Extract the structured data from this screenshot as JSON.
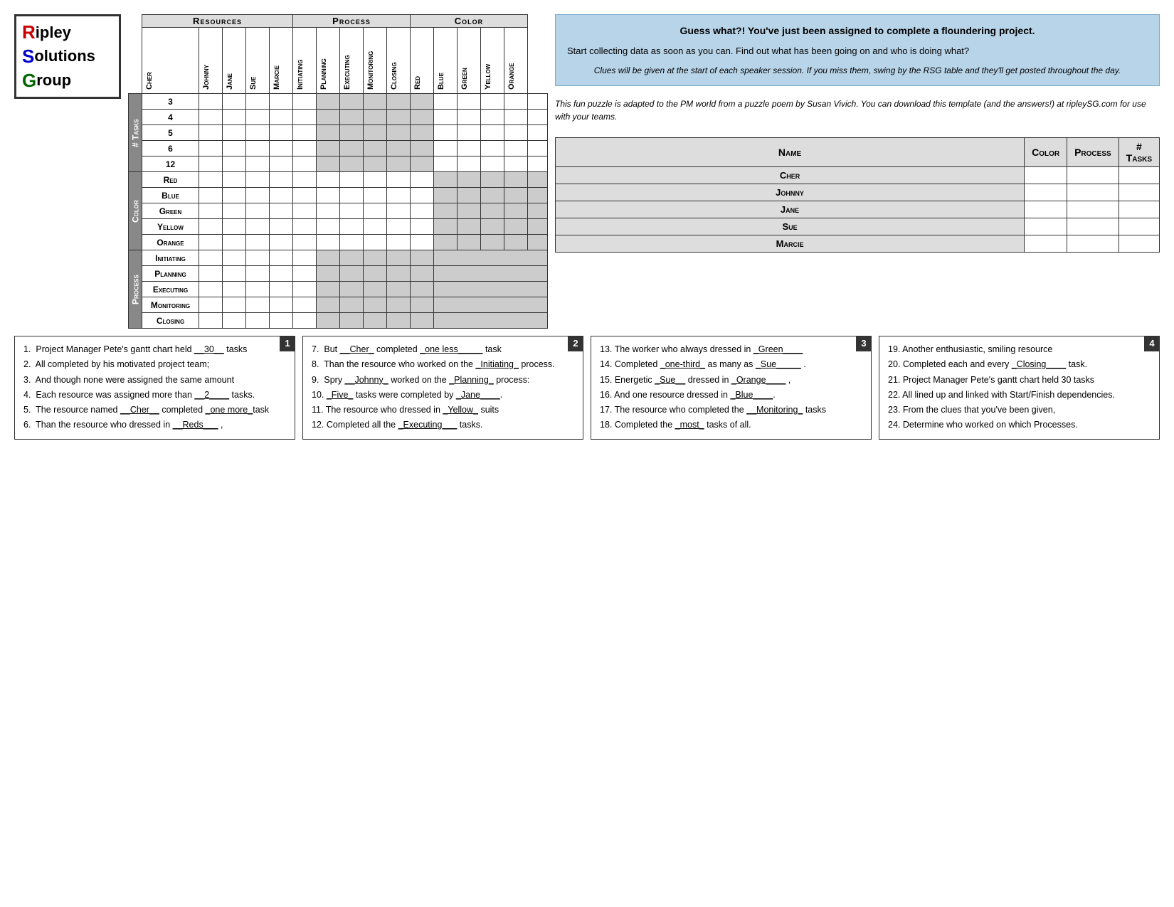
{
  "logo": {
    "line1_prefix": "R",
    "line1_rest": "ipley",
    "line2_prefix": "S",
    "line2_rest": "olutions",
    "line3_prefix": "G",
    "line3_rest": "roup"
  },
  "puzzle": {
    "resources_header": "Resources",
    "process_header": "Process",
    "color_header": "Color",
    "col_headers_resources": [
      "Cher",
      "Johnny",
      "Jane",
      "Sue",
      "Marcie"
    ],
    "col_headers_process": [
      "Initiating",
      "Planning",
      "Executing",
      "Monitoring",
      "Closing"
    ],
    "col_headers_color": [
      "Red",
      "Blue",
      "Green",
      "Yellow",
      "Orange"
    ],
    "row_groups": [
      {
        "label": "# Tasks",
        "rows": [
          "3",
          "4",
          "5",
          "6",
          "12"
        ]
      },
      {
        "label": "Color",
        "rows": [
          "Red",
          "Blue",
          "Green",
          "Yellow",
          "Orange"
        ]
      },
      {
        "label": "Process",
        "rows": [
          "Initiating",
          "Planning",
          "Executing",
          "Monitoring",
          "Closing"
        ]
      }
    ]
  },
  "info_panel": {
    "blue_box_title": "Guess what?! You've just been assigned to complete a floundering project.",
    "blue_box_body": "Start collecting data as soon as you can.  Find out what has been going on and who is doing what?",
    "blue_box_italic": "Clues will be given at the start of each speaker session.  If you miss them, swing by the RSG table and they'll get posted throughout the day.",
    "credits": "This fun puzzle is adapted to the PM world from a puzzle poem by Susan Vivich.  You can download this template (and the answers!) at ripleySG.com for use with your teams."
  },
  "answer_table": {
    "headers": [
      "Name",
      "Color",
      "Process",
      "# Tasks"
    ],
    "rows": [
      {
        "name": "Cher",
        "color": "",
        "process": "",
        "tasks": ""
      },
      {
        "name": "Johnny",
        "color": "",
        "process": "",
        "tasks": ""
      },
      {
        "name": "Jane",
        "color": "",
        "process": "",
        "tasks": ""
      },
      {
        "name": "Sue",
        "color": "",
        "process": "",
        "tasks": ""
      },
      {
        "name": "Marcie",
        "color": "",
        "process": "",
        "tasks": ""
      }
    ]
  },
  "clues": {
    "box1": [
      "1.  Project Manager Pete's gantt chart held __30__ tasks",
      "2.  All completed by his motivated project team;",
      "3.  And though none were assigned the same amount",
      "4.  Each resource was assigned more than __2____ tasks.",
      "5.  The resource named __Cher__ completed _one more_task",
      "6.  Than the resource who dressed in __Reds___ ,"
    ],
    "box2": [
      "7.  But __Cher_ completed _one less_____ task",
      "8.  Than the resource who worked on the _Initiating_ process.",
      "9.  Spry __Johnny_ worked on the _Planning_ process:",
      "10. _Five_ tasks were completed by _Jane____.",
      "11. The resource who dressed in _Yellow_ suits",
      "12. Completed all the _Executing___ tasks."
    ],
    "box3": [
      "13. The worker who always dressed in _Green____",
      "14. Completed _one-third_ as many as _Sue_____ .",
      "15. Energetic _Sue__ dressed in _Orange____ ,",
      "16. And one resource dressed in _Blue____.",
      "17. The resource who completed the __Monitoring_ tasks",
      "18. Completed the _most_ tasks of all."
    ],
    "box4": [
      "19. Another enthusiastic, smiling resource",
      "20. Completed each and every _Closing____ task.",
      "21. Project Manager Pete's gantt chart held 30 tasks",
      "22. All lined up and linked with Start/Finish dependencies.",
      "23. From the clues that you've been given,",
      "24. Determine who worked on which Processes."
    ]
  }
}
